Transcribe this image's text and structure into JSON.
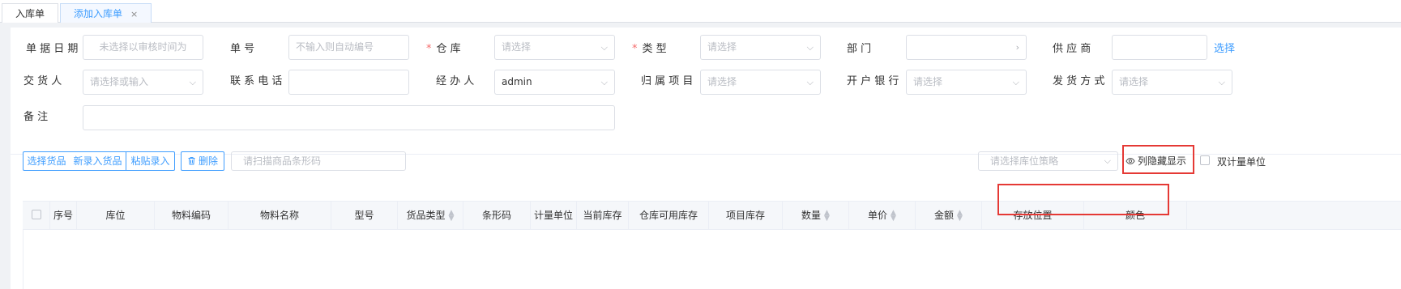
{
  "tabs": [
    {
      "label": "入库单"
    },
    {
      "label": "添加入库单",
      "close": "×"
    }
  ],
  "form": {
    "date": {
      "label": "单 据 日 期",
      "placeholder": "未选择以审核时间为"
    },
    "number": {
      "label": "单 号",
      "placeholder": "不输入则自动编号"
    },
    "warehouse": {
      "required": "*",
      "label": "仓 库",
      "placeholder": "请选择"
    },
    "type": {
      "required": "*",
      "label": "类 型",
      "placeholder": "请选择"
    },
    "dept": {
      "label": "部 门",
      "placeholder": ""
    },
    "supplier": {
      "label": "供 应 商",
      "placeholder": "",
      "link": "选择"
    },
    "deliverer": {
      "label": "交 货 人",
      "placeholder": "请选择或输入"
    },
    "phone": {
      "label": "联 系 电 话",
      "value": ""
    },
    "handler": {
      "label": "经 办 人",
      "value": "admin"
    },
    "project": {
      "label": "归 属 项 目",
      "placeholder": "请选择"
    },
    "bank": {
      "label": "开 户 银 行",
      "placeholder": "请选择"
    },
    "shipping": {
      "label": "发 货 方 式",
      "placeholder": "请选择"
    },
    "remark": {
      "label": "备 注",
      "value": ""
    }
  },
  "toolbar": {
    "select_goods": "选择货品",
    "new_goods": "新录入货品",
    "paste_entry": "粘贴录入",
    "delete": "删除",
    "scan_placeholder": "请扫描商品条形码",
    "strategy_placeholder": "请选择库位策略",
    "column_toggle": "列隐藏显示",
    "dual_unit": "双计量单位"
  },
  "table": {
    "headers": [
      "序号",
      "库位",
      "物料编码",
      "物料名称",
      "型号",
      "货品类型",
      "条形码",
      "计量单位",
      "当前库存",
      "仓库可用库存",
      "项目库存",
      "数量",
      "单价",
      "金额",
      "存放位置",
      "颜色"
    ]
  },
  "colors": {
    "accent": "#409eff",
    "required": "#f56c6c",
    "highlight": "#e53935"
  }
}
